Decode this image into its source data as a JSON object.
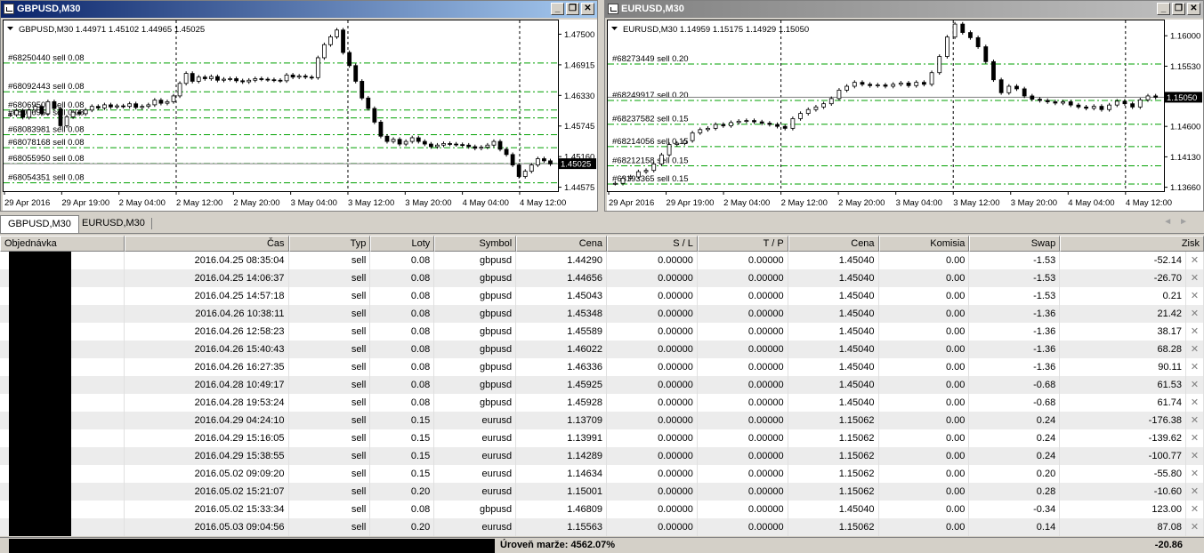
{
  "windows": [
    {
      "title": "GBPUSD,M30",
      "active": true,
      "header": "GBPUSD,M30  1.44971 1.45102 1.44965 1.45025",
      "ylim": [
        1.445,
        1.4778
      ],
      "price_ticks": [
        "1.47500",
        "1.46915",
        "1.46330",
        "1.45745",
        "1.45160",
        "1.44575"
      ],
      "current_price": "1.45025",
      "current_value": 1.45025,
      "time_labels": [
        "29 Apr 2016",
        "29 Apr 19:00",
        "2 May 04:00",
        "2 May 12:00",
        "2 May 20:00",
        "3 May 04:00",
        "3 May 12:00",
        "3 May 20:00",
        "4 May 04:00",
        "4 May 12:00"
      ],
      "order_lines": [
        {
          "label": "#68250440 sell 0.08",
          "price": 1.4695
        },
        {
          "label": "#68092443 sell 0.08",
          "price": 1.464
        },
        {
          "label": "#68069500 sell 0.08",
          "price": 1.4605
        },
        {
          "label": "#68076969 sell 0.08",
          "price": 1.459
        },
        {
          "label": "#68083981 sell 0.08",
          "price": 1.4558
        },
        {
          "label": "#68078168 sell 0.08",
          "price": 1.4533
        },
        {
          "label": "#68055950 sell 0.08",
          "price": 1.4503
        },
        {
          "label": "#68054351 sell 0.08",
          "price": 1.4466
        }
      ],
      "closes": [
        1.4596,
        1.4604,
        1.4591,
        1.4605,
        1.4612,
        1.4598,
        1.4621,
        1.4608,
        1.4575,
        1.4592,
        1.4601,
        1.4598,
        1.4605,
        1.4612,
        1.4609,
        1.4615,
        1.4611,
        1.4613,
        1.4612,
        1.4617,
        1.461,
        1.4612,
        1.4615,
        1.4624,
        1.4618,
        1.4621,
        1.4632,
        1.4656,
        1.4675,
        1.466,
        1.4668,
        1.4665,
        1.4669,
        1.4662,
        1.4664,
        1.4665,
        1.4661,
        1.4659,
        1.4662,
        1.4665,
        1.4664,
        1.4663,
        1.4662,
        1.4661,
        1.4672,
        1.4668,
        1.467,
        1.4668,
        1.4667,
        1.4705,
        1.473,
        1.4745,
        1.4758,
        1.4715,
        1.469,
        1.466,
        1.4628,
        1.4608,
        1.4582,
        1.4555,
        1.4545,
        1.4549,
        1.454,
        1.4545,
        1.4552,
        1.4545,
        1.454,
        1.4535,
        1.4538,
        1.4541,
        1.454,
        1.4539,
        1.4538,
        1.4535,
        1.4532,
        1.4534,
        1.4538,
        1.4545,
        1.453,
        1.452,
        1.45,
        1.4478,
        1.4488,
        1.45,
        1.4512,
        1.4508,
        1.4502
      ]
    },
    {
      "title": "EURUSD,M30",
      "active": false,
      "header": "EURUSD,M30  1.14959 1.15175 1.14929 1.15050",
      "ylim": [
        1.136,
        1.1625
      ],
      "price_ticks": [
        "1.16000",
        "1.15530",
        "1.15050",
        "1.14600",
        "1.14130",
        "1.13660"
      ],
      "current_price": "1.15050",
      "current_value": 1.1505,
      "time_labels": [
        "29 Apr 2016",
        "29 Apr 19:00",
        "2 May 04:00",
        "2 May 12:00",
        "2 May 20:00",
        "3 May 04:00",
        "3 May 12:00",
        "3 May 20:00",
        "4 May 04:00",
        "4 May 12:00"
      ],
      "order_lines": [
        {
          "label": "#68273449 sell 0.20",
          "price": 1.15563
        },
        {
          "label": "#68249917 sell 0.20",
          "price": 1.15001
        },
        {
          "label": "#68237582 sell 0.15",
          "price": 1.14634
        },
        {
          "label": "#68214056 sell 0.15",
          "price": 1.14289
        },
        {
          "label": "#68212158 sell 0.15",
          "price": 1.13991
        },
        {
          "label": "#68193365 sell 0.15",
          "price": 1.13709
        }
      ],
      "closes": [
        1.1372,
        1.138,
        1.1382,
        1.139,
        1.1392,
        1.1402,
        1.1416,
        1.1432,
        1.1434,
        1.1438,
        1.145,
        1.1455,
        1.1457,
        1.1463,
        1.1461,
        1.1466,
        1.1468,
        1.1469,
        1.1467,
        1.1465,
        1.1463,
        1.146,
        1.1457,
        1.1472,
        1.148,
        1.1486,
        1.149,
        1.1495,
        1.1503,
        1.1516,
        1.1522,
        1.1528,
        1.1525,
        1.1523,
        1.1524,
        1.1522,
        1.1525,
        1.1527,
        1.1523,
        1.1528,
        1.1525,
        1.1543,
        1.1568,
        1.1598,
        1.1618,
        1.1605,
        1.1597,
        1.1583,
        1.156,
        1.1532,
        1.1512,
        1.1522,
        1.1518,
        1.1507,
        1.1502,
        1.15,
        1.1498,
        1.1496,
        1.1498,
        1.1493,
        1.149,
        1.1488,
        1.1491,
        1.1486,
        1.1493,
        1.1499,
        1.1495,
        1.149,
        1.1501,
        1.1507,
        1.1505
      ]
    }
  ],
  "tabs": [
    "GBPUSD,M30",
    "EURUSD,M30"
  ],
  "table": {
    "columns": [
      "Objednávka",
      "Čas",
      "Typ",
      "Loty",
      "Symbol",
      "Cena",
      "S / L",
      "T / P",
      "Cena",
      "Komisia",
      "Swap",
      "Zisk"
    ],
    "rows": [
      [
        "2016.04.25 08:35:04",
        "sell",
        "0.08",
        "gbpusd",
        "1.44290",
        "0.00000",
        "0.00000",
        "1.45040",
        "0.00",
        "-1.53",
        "-52.14"
      ],
      [
        "2016.04.25 14:06:37",
        "sell",
        "0.08",
        "gbpusd",
        "1.44656",
        "0.00000",
        "0.00000",
        "1.45040",
        "0.00",
        "-1.53",
        "-26.70"
      ],
      [
        "2016.04.25 14:57:18",
        "sell",
        "0.08",
        "gbpusd",
        "1.45043",
        "0.00000",
        "0.00000",
        "1.45040",
        "0.00",
        "-1.53",
        "0.21"
      ],
      [
        "2016.04.26 10:38:11",
        "sell",
        "0.08",
        "gbpusd",
        "1.45348",
        "0.00000",
        "0.00000",
        "1.45040",
        "0.00",
        "-1.36",
        "21.42"
      ],
      [
        "2016.04.26 12:58:23",
        "sell",
        "0.08",
        "gbpusd",
        "1.45589",
        "0.00000",
        "0.00000",
        "1.45040",
        "0.00",
        "-1.36",
        "38.17"
      ],
      [
        "2016.04.26 15:40:43",
        "sell",
        "0.08",
        "gbpusd",
        "1.46022",
        "0.00000",
        "0.00000",
        "1.45040",
        "0.00",
        "-1.36",
        "68.28"
      ],
      [
        "2016.04.26 16:27:35",
        "sell",
        "0.08",
        "gbpusd",
        "1.46336",
        "0.00000",
        "0.00000",
        "1.45040",
        "0.00",
        "-1.36",
        "90.11"
      ],
      [
        "2016.04.28 10:49:17",
        "sell",
        "0.08",
        "gbpusd",
        "1.45925",
        "0.00000",
        "0.00000",
        "1.45040",
        "0.00",
        "-0.68",
        "61.53"
      ],
      [
        "2016.04.28 19:53:24",
        "sell",
        "0.08",
        "gbpusd",
        "1.45928",
        "0.00000",
        "0.00000",
        "1.45040",
        "0.00",
        "-0.68",
        "61.74"
      ],
      [
        "2016.04.29 04:24:10",
        "sell",
        "0.15",
        "eurusd",
        "1.13709",
        "0.00000",
        "0.00000",
        "1.15062",
        "0.00",
        "0.24",
        "-176.38"
      ],
      [
        "2016.04.29 15:16:05",
        "sell",
        "0.15",
        "eurusd",
        "1.13991",
        "0.00000",
        "0.00000",
        "1.15062",
        "0.00",
        "0.24",
        "-139.62"
      ],
      [
        "2016.04.29 15:38:55",
        "sell",
        "0.15",
        "eurusd",
        "1.14289",
        "0.00000",
        "0.00000",
        "1.15062",
        "0.00",
        "0.24",
        "-100.77"
      ],
      [
        "2016.05.02 09:09:20",
        "sell",
        "0.15",
        "eurusd",
        "1.14634",
        "0.00000",
        "0.00000",
        "1.15062",
        "0.00",
        "0.20",
        "-55.80"
      ],
      [
        "2016.05.02 15:21:07",
        "sell",
        "0.20",
        "eurusd",
        "1.15001",
        "0.00000",
        "0.00000",
        "1.15062",
        "0.00",
        "0.28",
        "-10.60"
      ],
      [
        "2016.05.02 15:33:34",
        "sell",
        "0.08",
        "gbpusd",
        "1.46809",
        "0.00000",
        "0.00000",
        "1.45040",
        "0.00",
        "-0.34",
        "123.00"
      ],
      [
        "2016.05.03 09:04:56",
        "sell",
        "0.20",
        "eurusd",
        "1.15563",
        "0.00000",
        "0.00000",
        "1.15062",
        "0.00",
        "0.14",
        "87.08"
      ]
    ]
  },
  "status": {
    "margin_level": "Úroveň marže: 4562.07%",
    "total_profit": "-20.86"
  },
  "colors": {
    "order_line": "#00a000",
    "price_highlight": "#000000",
    "active_title": "#0a246a",
    "inactive_title": "#808080"
  },
  "icons": [
    "chart-window-icon",
    "minimize-icon",
    "restore-icon",
    "close-icon",
    "close-order-icon"
  ]
}
